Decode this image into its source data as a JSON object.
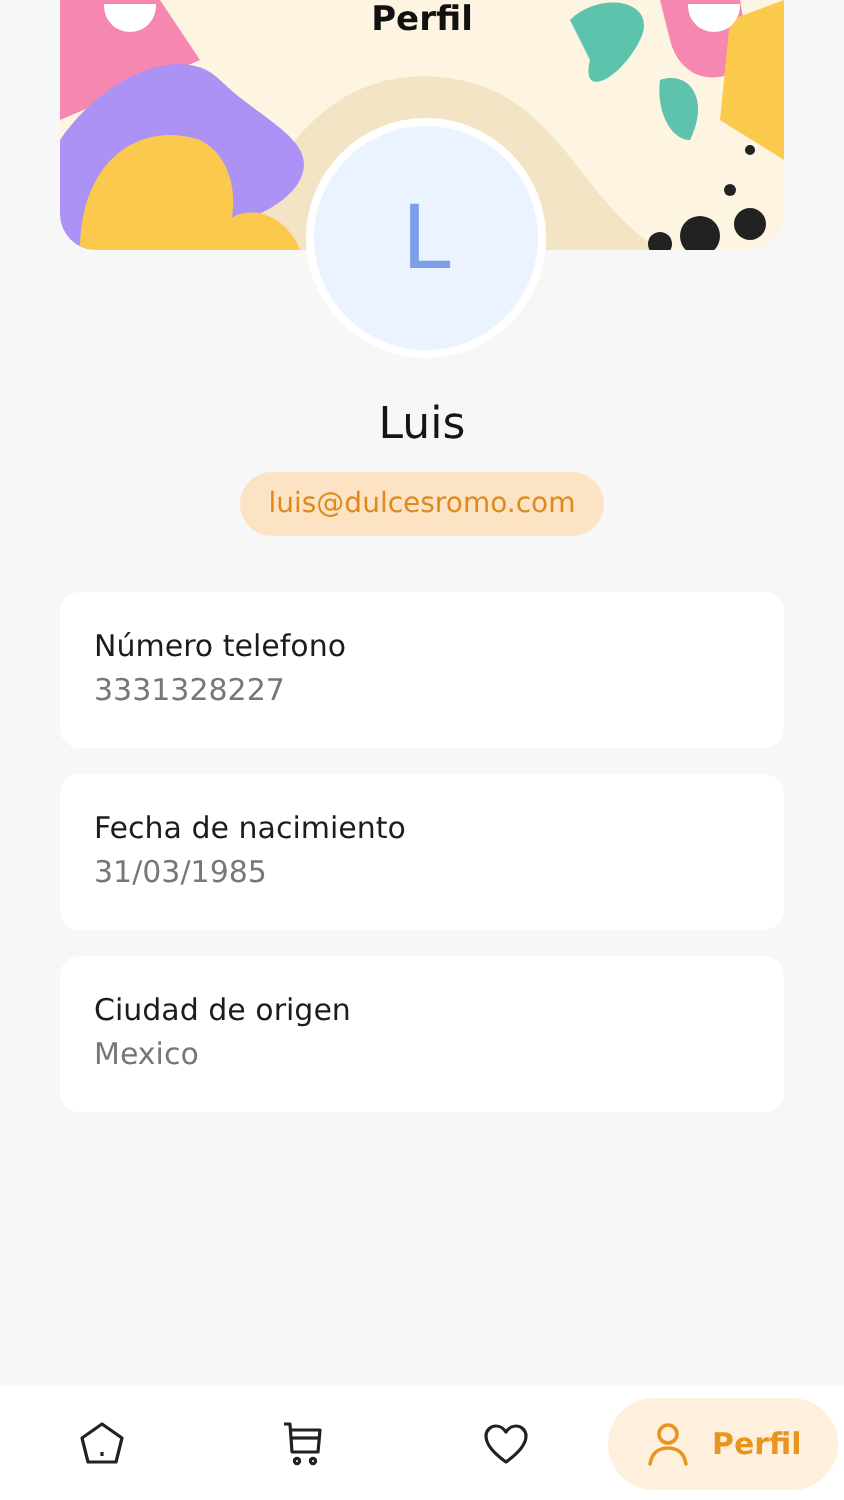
{
  "header": {
    "title": "Perfil"
  },
  "profile": {
    "avatar_letter": "L",
    "name": "Luis",
    "email": "luis@dulcesromo.com"
  },
  "fields": [
    {
      "label": "Número telefono",
      "value": "3331328227"
    },
    {
      "label": "Fecha de nacimiento",
      "value": "31/03/1985"
    },
    {
      "label": "Ciudad de origen",
      "value": "Mexico"
    }
  ],
  "nav": [
    {
      "kind": "home",
      "selected": false
    },
    {
      "kind": "cart",
      "selected": false
    },
    {
      "kind": "favorites",
      "selected": false
    },
    {
      "kind": "profile",
      "label": "Perfil",
      "selected": true
    }
  ]
}
